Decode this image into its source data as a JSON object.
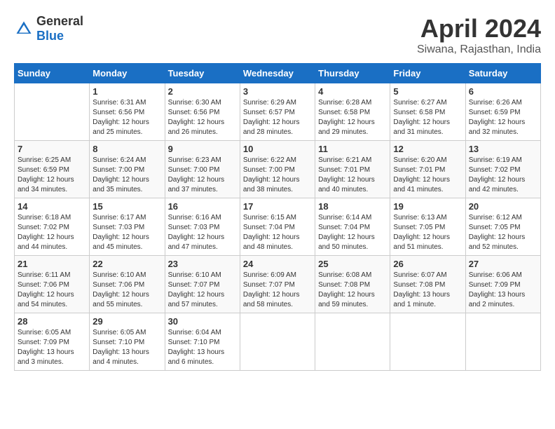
{
  "header": {
    "logo_general": "General",
    "logo_blue": "Blue",
    "title": "April 2024",
    "location": "Siwana, Rajasthan, India"
  },
  "calendar": {
    "days_of_week": [
      "Sunday",
      "Monday",
      "Tuesday",
      "Wednesday",
      "Thursday",
      "Friday",
      "Saturday"
    ],
    "weeks": [
      [
        {
          "day": "",
          "sunrise": "",
          "sunset": "",
          "daylight": ""
        },
        {
          "day": "1",
          "sunrise": "Sunrise: 6:31 AM",
          "sunset": "Sunset: 6:56 PM",
          "daylight": "Daylight: 12 hours and 25 minutes."
        },
        {
          "day": "2",
          "sunrise": "Sunrise: 6:30 AM",
          "sunset": "Sunset: 6:56 PM",
          "daylight": "Daylight: 12 hours and 26 minutes."
        },
        {
          "day": "3",
          "sunrise": "Sunrise: 6:29 AM",
          "sunset": "Sunset: 6:57 PM",
          "daylight": "Daylight: 12 hours and 28 minutes."
        },
        {
          "day": "4",
          "sunrise": "Sunrise: 6:28 AM",
          "sunset": "Sunset: 6:58 PM",
          "daylight": "Daylight: 12 hours and 29 minutes."
        },
        {
          "day": "5",
          "sunrise": "Sunrise: 6:27 AM",
          "sunset": "Sunset: 6:58 PM",
          "daylight": "Daylight: 12 hours and 31 minutes."
        },
        {
          "day": "6",
          "sunrise": "Sunrise: 6:26 AM",
          "sunset": "Sunset: 6:59 PM",
          "daylight": "Daylight: 12 hours and 32 minutes."
        }
      ],
      [
        {
          "day": "7",
          "sunrise": "Sunrise: 6:25 AM",
          "sunset": "Sunset: 6:59 PM",
          "daylight": "Daylight: 12 hours and 34 minutes."
        },
        {
          "day": "8",
          "sunrise": "Sunrise: 6:24 AM",
          "sunset": "Sunset: 7:00 PM",
          "daylight": "Daylight: 12 hours and 35 minutes."
        },
        {
          "day": "9",
          "sunrise": "Sunrise: 6:23 AM",
          "sunset": "Sunset: 7:00 PM",
          "daylight": "Daylight: 12 hours and 37 minutes."
        },
        {
          "day": "10",
          "sunrise": "Sunrise: 6:22 AM",
          "sunset": "Sunset: 7:00 PM",
          "daylight": "Daylight: 12 hours and 38 minutes."
        },
        {
          "day": "11",
          "sunrise": "Sunrise: 6:21 AM",
          "sunset": "Sunset: 7:01 PM",
          "daylight": "Daylight: 12 hours and 40 minutes."
        },
        {
          "day": "12",
          "sunrise": "Sunrise: 6:20 AM",
          "sunset": "Sunset: 7:01 PM",
          "daylight": "Daylight: 12 hours and 41 minutes."
        },
        {
          "day": "13",
          "sunrise": "Sunrise: 6:19 AM",
          "sunset": "Sunset: 7:02 PM",
          "daylight": "Daylight: 12 hours and 42 minutes."
        }
      ],
      [
        {
          "day": "14",
          "sunrise": "Sunrise: 6:18 AM",
          "sunset": "Sunset: 7:02 PM",
          "daylight": "Daylight: 12 hours and 44 minutes."
        },
        {
          "day": "15",
          "sunrise": "Sunrise: 6:17 AM",
          "sunset": "Sunset: 7:03 PM",
          "daylight": "Daylight: 12 hours and 45 minutes."
        },
        {
          "day": "16",
          "sunrise": "Sunrise: 6:16 AM",
          "sunset": "Sunset: 7:03 PM",
          "daylight": "Daylight: 12 hours and 47 minutes."
        },
        {
          "day": "17",
          "sunrise": "Sunrise: 6:15 AM",
          "sunset": "Sunset: 7:04 PM",
          "daylight": "Daylight: 12 hours and 48 minutes."
        },
        {
          "day": "18",
          "sunrise": "Sunrise: 6:14 AM",
          "sunset": "Sunset: 7:04 PM",
          "daylight": "Daylight: 12 hours and 50 minutes."
        },
        {
          "day": "19",
          "sunrise": "Sunrise: 6:13 AM",
          "sunset": "Sunset: 7:05 PM",
          "daylight": "Daylight: 12 hours and 51 minutes."
        },
        {
          "day": "20",
          "sunrise": "Sunrise: 6:12 AM",
          "sunset": "Sunset: 7:05 PM",
          "daylight": "Daylight: 12 hours and 52 minutes."
        }
      ],
      [
        {
          "day": "21",
          "sunrise": "Sunrise: 6:11 AM",
          "sunset": "Sunset: 7:06 PM",
          "daylight": "Daylight: 12 hours and 54 minutes."
        },
        {
          "day": "22",
          "sunrise": "Sunrise: 6:10 AM",
          "sunset": "Sunset: 7:06 PM",
          "daylight": "Daylight: 12 hours and 55 minutes."
        },
        {
          "day": "23",
          "sunrise": "Sunrise: 6:10 AM",
          "sunset": "Sunset: 7:07 PM",
          "daylight": "Daylight: 12 hours and 57 minutes."
        },
        {
          "day": "24",
          "sunrise": "Sunrise: 6:09 AM",
          "sunset": "Sunset: 7:07 PM",
          "daylight": "Daylight: 12 hours and 58 minutes."
        },
        {
          "day": "25",
          "sunrise": "Sunrise: 6:08 AM",
          "sunset": "Sunset: 7:08 PM",
          "daylight": "Daylight: 12 hours and 59 minutes."
        },
        {
          "day": "26",
          "sunrise": "Sunrise: 6:07 AM",
          "sunset": "Sunset: 7:08 PM",
          "daylight": "Daylight: 13 hours and 1 minute."
        },
        {
          "day": "27",
          "sunrise": "Sunrise: 6:06 AM",
          "sunset": "Sunset: 7:09 PM",
          "daylight": "Daylight: 13 hours and 2 minutes."
        }
      ],
      [
        {
          "day": "28",
          "sunrise": "Sunrise: 6:05 AM",
          "sunset": "Sunset: 7:09 PM",
          "daylight": "Daylight: 13 hours and 3 minutes."
        },
        {
          "day": "29",
          "sunrise": "Sunrise: 6:05 AM",
          "sunset": "Sunset: 7:10 PM",
          "daylight": "Daylight: 13 hours and 4 minutes."
        },
        {
          "day": "30",
          "sunrise": "Sunrise: 6:04 AM",
          "sunset": "Sunset: 7:10 PM",
          "daylight": "Daylight: 13 hours and 6 minutes."
        },
        {
          "day": "",
          "sunrise": "",
          "sunset": "",
          "daylight": ""
        },
        {
          "day": "",
          "sunrise": "",
          "sunset": "",
          "daylight": ""
        },
        {
          "day": "",
          "sunrise": "",
          "sunset": "",
          "daylight": ""
        },
        {
          "day": "",
          "sunrise": "",
          "sunset": "",
          "daylight": ""
        }
      ]
    ]
  }
}
